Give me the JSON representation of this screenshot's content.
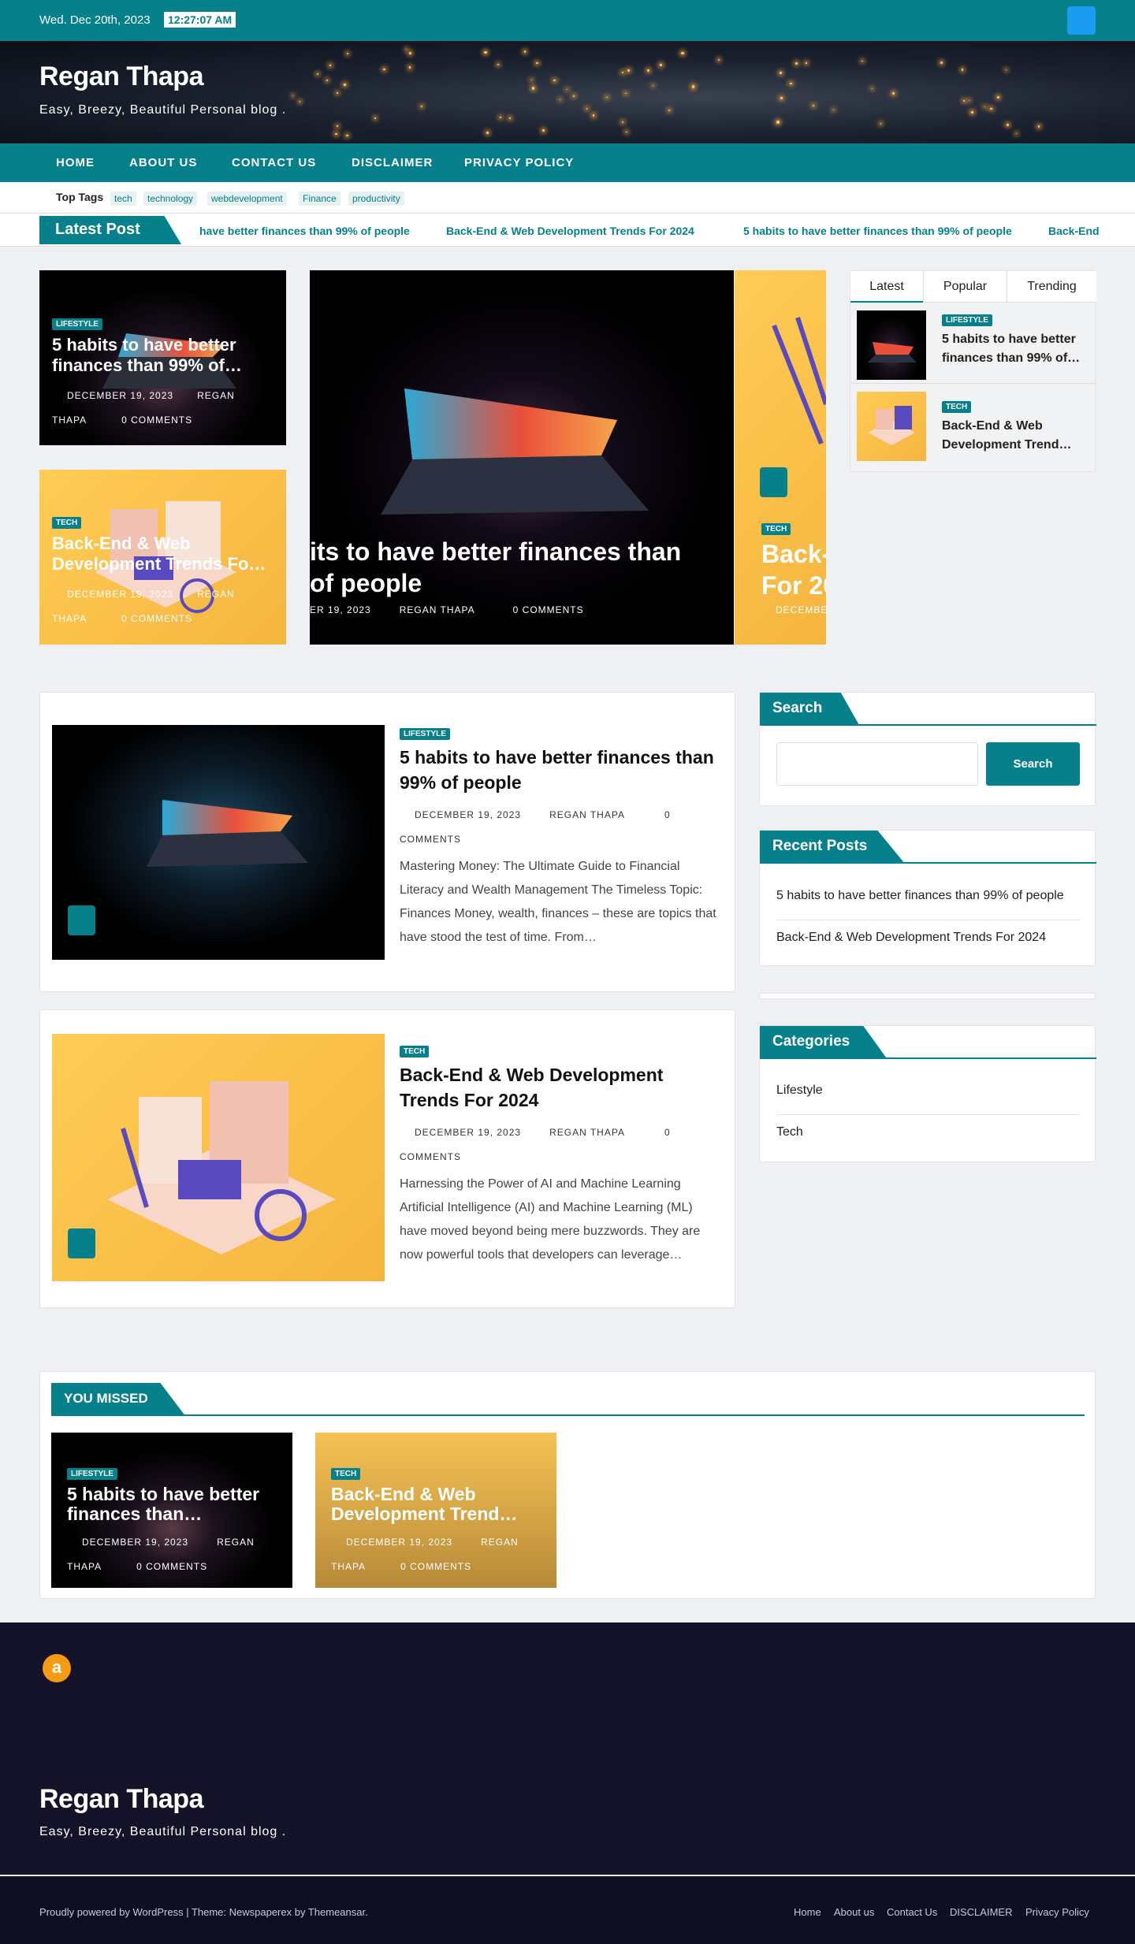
{
  "topbar": {
    "date": "Wed. Dec 20th, 2023",
    "time": "12:27:07 AM"
  },
  "site": {
    "title": "Regan Thapa",
    "tagline": "Easy, Breezy, Beautiful Personal blog ."
  },
  "nav": [
    "HOME",
    "ABOUT US",
    "CONTACT US",
    "DISCLAIMER",
    "PRIVACY POLICY"
  ],
  "top_tags": {
    "label": "Top Tags",
    "tags": [
      "tech",
      "technology",
      "webdevelopment",
      "Finance",
      "productivity"
    ]
  },
  "ticker": {
    "label": "Latest Post",
    "items": [
      "have better finances than 99% of people",
      "Back-End & Web Development Trends For 2024",
      "5 habits to have better finances than 99% of people",
      "Back-End"
    ]
  },
  "featured": {
    "card1": {
      "category": "LIFESTYLE",
      "title": "5 habits to have better finances than 99% of…",
      "date": "DECEMBER 19, 2023",
      "author_a": "REGAN",
      "author_b": "THAPA",
      "comments": "0 COMMENTS"
    },
    "card2": {
      "category": "TECH",
      "title": "Back-End & Web Development Trends Fo…",
      "date": "DECEMBER 19, 2023",
      "author_a": "REGAN",
      "author_b": "THAPA",
      "comments": "0 COMMENTS"
    },
    "slide": {
      "title_l1": "its to have better finances than",
      "title_l2": "of people",
      "date": "ER 19, 2023",
      "author": "REGAN THAPA",
      "comments": "0 COMMENTS"
    },
    "slide_next": {
      "category": "TECH",
      "title_l1": "Back-",
      "title_l2": "For 20",
      "date": "DECEMBE"
    }
  },
  "tabs": {
    "labels": [
      "Latest",
      "Popular",
      "Trending"
    ],
    "items": [
      {
        "category": "LIFESTYLE",
        "title": "5 habits to have better finances than 99% of…"
      },
      {
        "category": "TECH",
        "title": "Back-End & Web Development Trend…"
      }
    ]
  },
  "posts": [
    {
      "category": "LIFESTYLE",
      "title": "5 habits to have better finances than 99% of people",
      "date": "DECEMBER 19, 2023",
      "author": "REGAN THAPA",
      "comments_a": "0",
      "comments_b": "COMMENTS",
      "excerpt": "Mastering Money: The Ultimate Guide to Financial Literacy and Wealth Management The Timeless Topic: Finances Money, wealth, finances – these are topics that have stood the test of time. From…"
    },
    {
      "category": "TECH",
      "title": "Back-End & Web Development Trends For 2024",
      "date": "DECEMBER 19, 2023",
      "author": "REGAN THAPA",
      "comments_a": "0",
      "comments_b": "COMMENTS",
      "excerpt": "Harnessing the Power of AI and Machine Learning Artificial Intelligence (AI) and Machine Learning (ML) have moved beyond being mere buzzwords. They are now powerful tools that developers can leverage…"
    }
  ],
  "sidebar": {
    "search": {
      "heading": "Search",
      "button": "Search",
      "placeholder": ""
    },
    "recent": {
      "heading": "Recent Posts",
      "items": [
        "5 habits to have better finances than 99% of people",
        "Back-End & Web Development Trends For 2024"
      ]
    },
    "categories": {
      "heading": "Categories",
      "items": [
        "Lifestyle",
        "Tech"
      ]
    }
  },
  "missed": {
    "heading": "YOU MISSED",
    "items": [
      {
        "category": "LIFESTYLE",
        "title": "5 habits to have better finances than…",
        "date": "DECEMBER 19, 2023",
        "author_a": "REGAN",
        "author_b": "THAPA",
        "comments": "0 COMMENTS"
      },
      {
        "category": "TECH",
        "title": "Back-End & Web Development Trend…",
        "date": "DECEMBER 19, 2023",
        "author_a": "REGAN",
        "author_b": "THAPA",
        "comments": "0 COMMENTS"
      }
    ]
  },
  "footer": {
    "title": "Regan Thapa",
    "tagline": "Easy, Breezy, Beautiful Personal blog .",
    "amazon_icon": "amazon-icon"
  },
  "bottom": {
    "credit_a": "Proudly powered by WordPress",
    "credit_sep": " | Theme: Newspaperex by ",
    "credit_b": "Themeansar.",
    "links": [
      "Home",
      "About us",
      "Contact Us",
      "DISCLAIMER",
      "Privacy Policy"
    ]
  },
  "colors": {
    "primary": "#06808a",
    "accent_blue": "#1a9cf0",
    "footer_bg": "#14132a"
  }
}
